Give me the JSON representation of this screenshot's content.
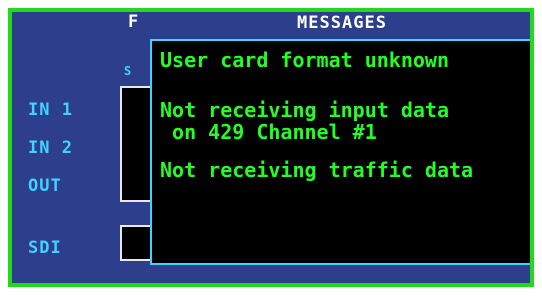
{
  "background_page": {
    "title_fragment": "F",
    "sub_fragment": "S",
    "rows": [
      {
        "label": "IN 1"
      },
      {
        "label": "IN 2"
      },
      {
        "label": "OUT"
      },
      {
        "label": "SDI"
      }
    ]
  },
  "messages_window": {
    "title": "MESSAGES",
    "messages": [
      {
        "line1": "User card format unknown",
        "line2": ""
      },
      {
        "line1": "Not receiving input data",
        "line2": " on 429 Channel #1"
      },
      {
        "line1": "Not receiving traffic data",
        "line2": ""
      }
    ]
  },
  "colors": {
    "screen_bg": "#2d3e8c",
    "border_green": "#23d91b",
    "message_green": "#23ff23",
    "cyan": "#3fd3ff"
  }
}
